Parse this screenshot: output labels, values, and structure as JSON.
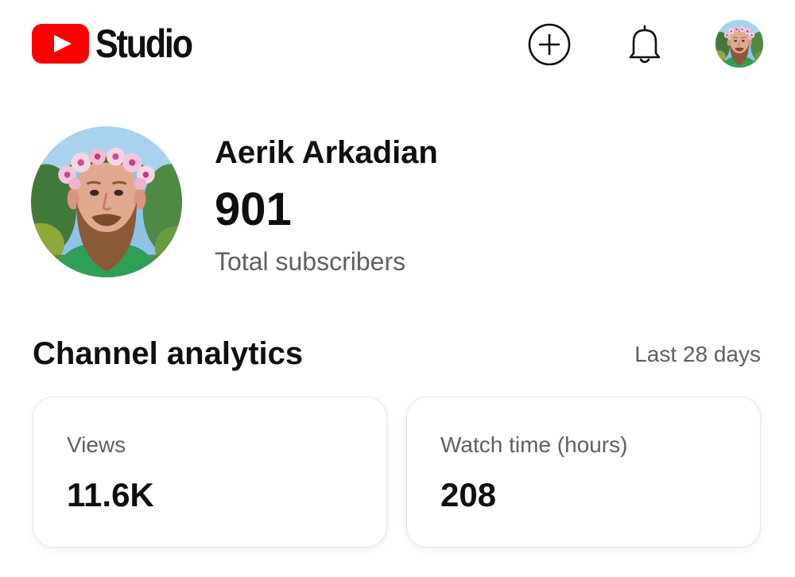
{
  "app": {
    "logo_text": "Studio",
    "brand_color": "#ff0000"
  },
  "header": {
    "create_icon": "plus-circle-icon",
    "notifications_icon": "bell-icon",
    "account_icon": "avatar"
  },
  "channel": {
    "name": "Aerik Arkadian",
    "subscriber_count": "901",
    "subscriber_label": "Total subscribers"
  },
  "analytics": {
    "title": "Channel analytics",
    "period": "Last 28 days",
    "cards": [
      {
        "label": "Views",
        "value": "11.6K"
      },
      {
        "label": "Watch time (hours)",
        "value": "208"
      }
    ]
  },
  "colors": {
    "primary_text": "#0f0f0f",
    "secondary_text": "#606060",
    "card_border": "#e5e5e5"
  }
}
